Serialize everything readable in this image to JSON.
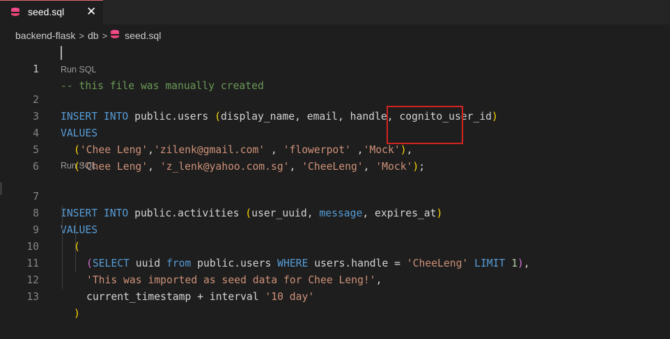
{
  "tab": {
    "filename": "seed.sql",
    "close_glyph": "✕",
    "icon": "database-icon"
  },
  "breadcrumb": [
    "backend-flask",
    "db",
    "seed.sql"
  ],
  "breadcrumb_separator": ">",
  "codelens": [
    "Run SQL",
    "Run SQL"
  ],
  "line_numbers": [
    "1",
    "2",
    "3",
    "4",
    "5",
    "6",
    "7",
    "8",
    "9",
    "10",
    "11",
    "12",
    "13"
  ],
  "code": {
    "l1": {
      "comment": "-- this file was manually created"
    },
    "l2": {
      "kw1": "INSERT",
      "kw2": "INTO",
      "table": "public.users",
      "open": "(",
      "cols": "display_name, email, handle, cognito_user_id",
      "close": ")"
    },
    "l3": {
      "kw": "VALUES"
    },
    "l4": {
      "open": "(",
      "s1": "'Chee Leng'",
      "c1": ",",
      "s2": "'zilenk@gmail.com'",
      "c2": " , ",
      "s3": "'flowerpot'",
      "c3": " ,",
      "s4": "'Mock'",
      "close": ")",
      "end": ","
    },
    "l5": {
      "open": "(",
      "s1": "'Chee Leng'",
      "c1": ", ",
      "s2": "'z_lenk@yahoo.com.sg'",
      "c2": ", ",
      "s3": "'CheeLeng'",
      "c3": ", ",
      "s4": "'Mock'",
      "close": ")",
      "end": ";"
    },
    "l7": {
      "kw1": "INSERT",
      "kw2": "INTO",
      "table": "public.activities",
      "open": "(",
      "c1": "user_uuid, ",
      "msg": "message",
      "c2": ", expires_at",
      "close": ")"
    },
    "l8": {
      "kw": "VALUES"
    },
    "l9": {
      "open": "("
    },
    "l10": {
      "open": "(",
      "kw_select": "SELECT",
      "uuid": " uuid ",
      "kw_from": "from",
      "tbl": " public.users ",
      "kw_where": "WHERE",
      "cond": " users.handle = ",
      "s": "'CheeLeng'",
      "sp": " ",
      "kw_limit": "LIMIT",
      "sp2": " ",
      "num": "1",
      "close": ")",
      "end": ","
    },
    "l11": {
      "s": "'This was imported as seed data for Chee Leng!'",
      "end": ","
    },
    "l12": {
      "a": "current_timestamp + interval ",
      "s": "'10 day'"
    },
    "l13": {
      "close": ")"
    }
  },
  "colors": {
    "accent_box": "#d42222",
    "keyword": "#569cd6",
    "string": "#ce9178",
    "comment": "#6a9955"
  }
}
